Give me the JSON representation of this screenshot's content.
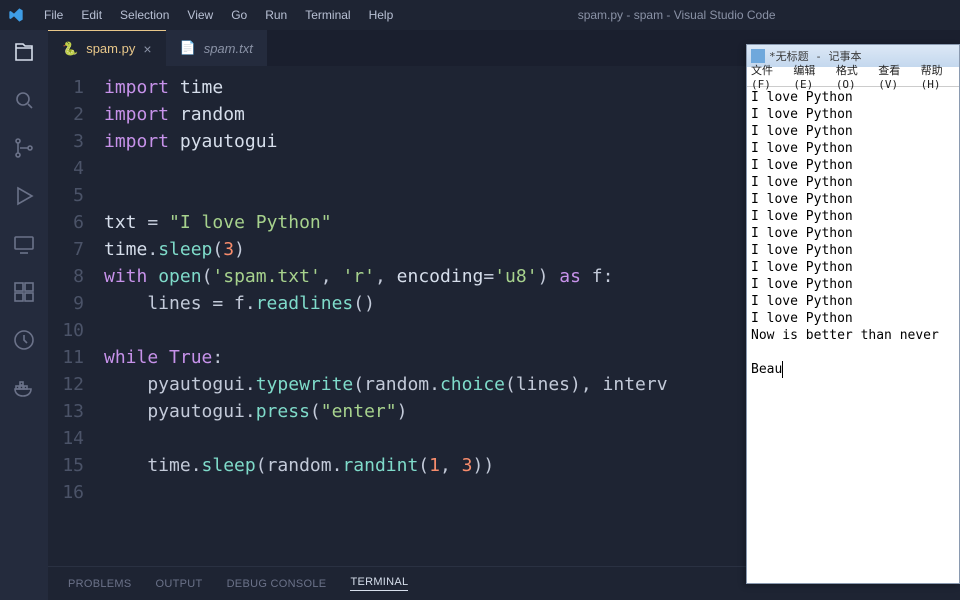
{
  "window": {
    "title": "spam.py - spam - Visual Studio Code"
  },
  "menubar": [
    "File",
    "Edit",
    "Selection",
    "View",
    "Go",
    "Run",
    "Terminal",
    "Help"
  ],
  "activitybar": [
    {
      "name": "explorer-icon",
      "active": true
    },
    {
      "name": "search-icon",
      "active": false
    },
    {
      "name": "source-control-icon",
      "active": false
    },
    {
      "name": "run-debug-icon",
      "active": false
    },
    {
      "name": "remote-icon",
      "active": false
    },
    {
      "name": "extensions-icon",
      "active": false
    },
    {
      "name": "timeline-icon",
      "active": false
    },
    {
      "name": "docker-icon",
      "active": false
    }
  ],
  "tabs": [
    {
      "label": "spam.py",
      "type": "py",
      "active": true,
      "closeable": true
    },
    {
      "label": "spam.txt",
      "type": "txt",
      "active": false,
      "closeable": false
    }
  ],
  "code": {
    "lines": [
      [
        [
          "kw",
          "import"
        ],
        [
          "",
          " "
        ],
        [
          "var",
          "time"
        ]
      ],
      [
        [
          "kw",
          "import"
        ],
        [
          "",
          " "
        ],
        [
          "var",
          "random"
        ]
      ],
      [
        [
          "kw",
          "import"
        ],
        [
          "",
          " "
        ],
        [
          "var",
          "pyautogui"
        ]
      ],
      [],
      [],
      [
        [
          "var",
          "txt "
        ],
        [
          "",
          "= "
        ],
        [
          "str",
          "\"I love Python\""
        ]
      ],
      [
        [
          "var",
          "time"
        ],
        [
          "",
          "."
        ],
        [
          "fn",
          "sleep"
        ],
        [
          "",
          "("
        ],
        [
          "num",
          "3"
        ],
        [
          "",
          ")"
        ]
      ],
      [
        [
          "kw",
          "with"
        ],
        [
          "",
          " "
        ],
        [
          "fn",
          "open"
        ],
        [
          "",
          "("
        ],
        [
          "str",
          "'spam.txt'"
        ],
        [
          "",
          ", "
        ],
        [
          "str",
          "'r'"
        ],
        [
          "",
          ", "
        ],
        [
          "var",
          "encoding"
        ],
        [
          "",
          "="
        ],
        [
          "str",
          "'u8'"
        ],
        [
          "",
          ") "
        ],
        [
          "kw",
          "as"
        ],
        [
          "",
          " f:"
        ]
      ],
      [
        [
          "",
          "    lines = f."
        ],
        [
          "fn",
          "readlines"
        ],
        [
          "",
          "()"
        ]
      ],
      [],
      [
        [
          "kw",
          "while"
        ],
        [
          "",
          " "
        ],
        [
          "kw",
          "True"
        ],
        [
          "",
          ":"
        ]
      ],
      [
        [
          "",
          "    pyautogui."
        ],
        [
          "fn",
          "typewrite"
        ],
        [
          "",
          "(random."
        ],
        [
          "fn",
          "choice"
        ],
        [
          "",
          "(lines), interv"
        ]
      ],
      [
        [
          "",
          "    pyautogui."
        ],
        [
          "fn",
          "press"
        ],
        [
          "",
          "("
        ],
        [
          "str",
          "\"enter\""
        ],
        [
          "",
          ")"
        ]
      ],
      [],
      [
        [
          "",
          "    time."
        ],
        [
          "fn",
          "sleep"
        ],
        [
          "",
          "(random."
        ],
        [
          "fn",
          "randint"
        ],
        [
          "",
          "("
        ],
        [
          "num",
          "1"
        ],
        [
          "",
          ", "
        ],
        [
          "num",
          "3"
        ],
        [
          "",
          "))"
        ]
      ],
      []
    ]
  },
  "terminal_tabs": [
    {
      "label": "PROBLEMS",
      "active": false
    },
    {
      "label": "OUTPUT",
      "active": false
    },
    {
      "label": "DEBUG CONSOLE",
      "active": false
    },
    {
      "label": "TERMINAL",
      "active": true
    }
  ],
  "notepad": {
    "title": "*无标题 - 记事本",
    "menus": [
      "文件(F)",
      "编辑(E)",
      "格式(O)",
      "查看(V)",
      "帮助(H)"
    ],
    "lines": [
      "I love Python",
      "I love Python",
      "I love Python",
      "I love Python",
      "I love Python",
      "I love Python",
      "I love Python",
      "I love Python",
      "I love Python",
      "I love Python",
      "I love Python",
      "I love Python",
      "I love Python",
      "I love Python",
      "Now is better than never",
      "",
      "Beau"
    ]
  }
}
